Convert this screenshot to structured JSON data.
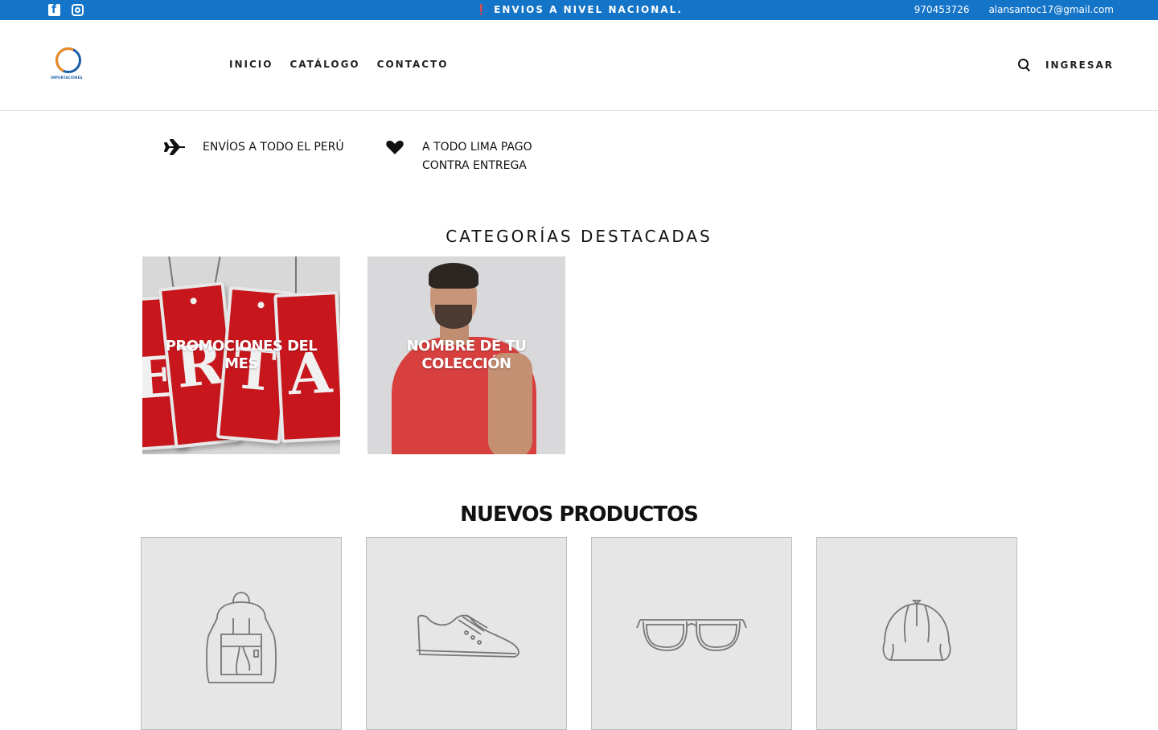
{
  "topbar": {
    "background": "#1474c8",
    "social_icons": [
      "facebook-icon",
      "instagram-icon"
    ],
    "announcement": "ENVIOS A NIVEL NACIONAL.",
    "phone": "970453726",
    "email": "alansantoc17@gmail.com"
  },
  "header": {
    "logo_text": "IMPORTACIONES",
    "nav": [
      "INICIO",
      "CATÁLOGO",
      "CONTACTO"
    ],
    "login": "INGRESAR"
  },
  "features": [
    {
      "icon": "airplane-icon",
      "line1": "ENVÍOS A TODO EL PERÚ",
      "line2": ""
    },
    {
      "icon": "heart-icon",
      "line1": "A TODO LIMA PAGO",
      "line2": "CONTRA ENTREGA"
    }
  ],
  "categories": {
    "title": "CATEGORÍAS DESTACADAS",
    "items": [
      {
        "label": "PROMOCIONES DEL MES"
      },
      {
        "label": "NOMBRE DE TU COLECCIÓN"
      }
    ]
  },
  "products": {
    "title": "NUEVOS PRODUCTOS",
    "items": [
      {
        "icon": "backpack-icon"
      },
      {
        "icon": "sneaker-icon"
      },
      {
        "icon": "glasses-icon"
      },
      {
        "icon": "cap-icon"
      }
    ]
  }
}
